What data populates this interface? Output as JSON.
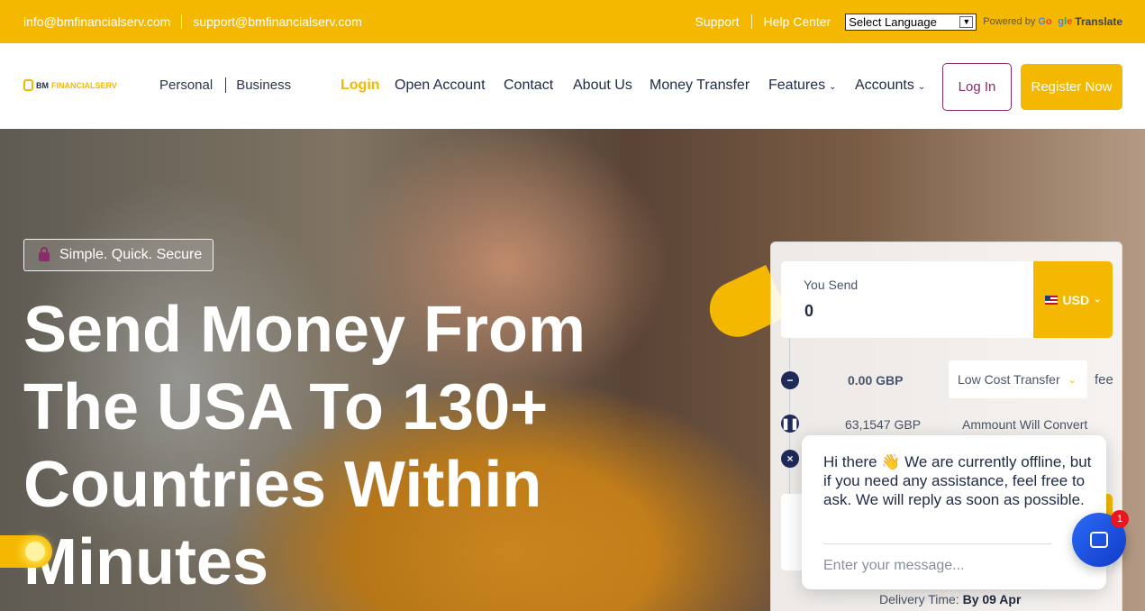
{
  "topbar": {
    "email_info": "info@bmfinancialserv.com",
    "email_support": "support@bmfinancialserv.com",
    "support": "Support",
    "help_center": "Help Center",
    "language_selected": "Select Language",
    "powered_by": "Powered by",
    "google": "Google",
    "translate": "Translate"
  },
  "nav": {
    "logo_bm": "BM",
    "logo_fin": "FINANCIALSERV",
    "personal": "Personal",
    "business": "Business",
    "items": [
      {
        "label": "Login",
        "active": true
      },
      {
        "label": "Open Account"
      },
      {
        "label": "Contact"
      },
      {
        "label": "About Us"
      },
      {
        "label": "Money Transfer"
      },
      {
        "label": "Features"
      },
      {
        "label": "Accounts"
      }
    ],
    "login_button": "Log In",
    "register_button": "Register Now"
  },
  "hero": {
    "badge": "Simple. Quick. Secure",
    "headline": "Send Money From The USA To 130+ Countries Within Minutes"
  },
  "calculator": {
    "you_send_label": "You Send",
    "you_send_value": "0",
    "currency": "USD",
    "fee_value": "0.00 GBP",
    "transfer_type": "Low Cost Transfer",
    "fee_label": "fee",
    "rate_value": "63,1547 GBP",
    "rate_label": "Ammount Will Convert",
    "delivery_label": "Delivery Time:",
    "delivery_value": "By 09 Apr"
  },
  "chat": {
    "message": "Hi there 👋 We are currently offline, but if you need any assistance, feel free to ask. We will reply as soon as possible.",
    "input_placeholder": "Enter your message...",
    "unread_count": "1"
  },
  "colors": {
    "brand_yellow": "#f5b800",
    "navy": "#1f2a44",
    "accent_purple": "#8a2b6a",
    "chat_blue": "#2a6cf5"
  }
}
